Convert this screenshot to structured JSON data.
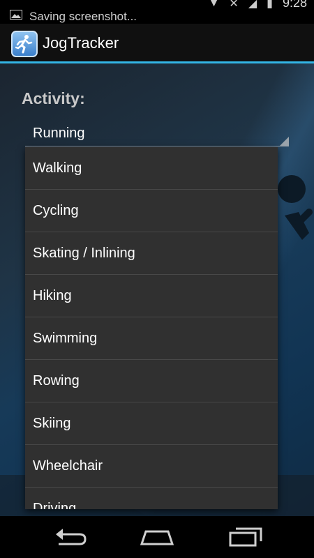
{
  "status_bar": {
    "notification_text": "Saving screenshot...",
    "clock": "9:28",
    "notif_icon": "image-icon"
  },
  "action_bar": {
    "app_title": "JogTracker",
    "app_icon": "runner-icon",
    "accent_color": "#33b5e5"
  },
  "form": {
    "activity_label": "Activity:",
    "selected_activity": "Running"
  },
  "dropdown": {
    "items": [
      "Walking",
      "Cycling",
      "Skating / Inlining",
      "Hiking",
      "Swimming",
      "Rowing",
      "Skiing",
      "Wheelchair",
      "Driving"
    ]
  },
  "nav_bar": {
    "back": "back-icon",
    "home": "home-icon",
    "recents": "recents-icon"
  }
}
